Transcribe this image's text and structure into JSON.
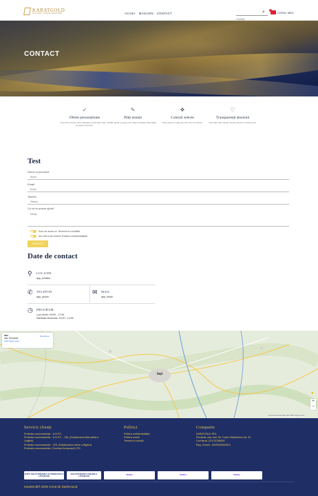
{
  "header": {
    "logo_text": "KARATGOLD",
    "logo_sub": "BIJUTERII ONLINE MAGAZINE",
    "nav": [
      "ACASA",
      "MAGAZIN",
      "CONTACT"
    ],
    "search_placeholder": "Cautare",
    "cart_label": "COSUL MEU",
    "cart_count": "0"
  },
  "hero": {
    "title": "CONTACT"
  },
  "features": [
    {
      "icon": "✓",
      "title": "Oferte personalizate",
      "desc": "Promotii si oferte unice adaptate preferintelor tale, cu beneficii exclusive."
    },
    {
      "icon": "✎",
      "title": "Plăți instant",
      "desc": "Plăți rapide si sigure prin toate metodele disponibile."
    },
    {
      "icon": "❖",
      "title": "Colecții selecte",
      "desc": "Piese alese cu grija din cele mai noi colectii."
    },
    {
      "icon": "♡",
      "title": "Transparență absolută",
      "desc": "Informatii clare despre fiecare produs si fiecare pret."
    }
  ],
  "form": {
    "title": "Test",
    "fields": [
      {
        "label": "Nume și prenume",
        "placeholder": "Nume"
      },
      {
        "label": "Email",
        "placeholder": "Email"
      },
      {
        "label": "Telefon",
        "placeholder": "Telefon"
      }
    ],
    "message_label": "Cu ce te putem ajuta?",
    "message_placeholder": "Mesaj",
    "toggle_terms": "Sunt de acord cu Termenii si conditiile",
    "toggle_privacy": "Am citit si am inteles Politica confidentialitatii",
    "submit": "TRIMITE"
  },
  "contact": {
    "title": "Date de contact",
    "location_label": "LOCAȚIE",
    "location_value": "app_location",
    "phone_label": "TELEFON",
    "phone_value": "app_phone",
    "mail_label": "MAIL",
    "mail_value": "app_email",
    "program_label": "PROGRAM",
    "program_line1": "Luni-Vineri: 09:00 - 17:00",
    "program_line2": "Sambata-Duminica: 10:00 - 14:00"
  },
  "map": {
    "box_title": "Iasi",
    "box_sub": "Iasi, Romania",
    "box_link": "View larger map",
    "directions": "Directions",
    "city": "Iași",
    "attribution": "Keyboard shortcuts  Map data ©2025 Google  Terms"
  },
  "footer": {
    "col1_title": "Servicii clienți",
    "col1_links": [
      "Protecția consumatorilor - A.N.P.C.",
      "Protecția consumatorilor - A.N.P.C. - SAL (Soluționarea Alternativă a Litigiilor)",
      "Protecția consumatorilor - SOL (Soluționarea online a litigiilor)",
      "Protecția consumatorilor | Comisia Europeană | RO"
    ],
    "col2_title": "Politici",
    "col2_links": [
      "Politica confidențialitate",
      "Politica cookie",
      "Termeni si condiții"
    ],
    "col3_title": "Companie",
    "col3_lines": [
      "KARATGOLD SRL",
      "Romania, Iasi, Iasi, Str. Tudor Vladimirescu Nr. 42",
      "Cod fiscal | CUI 51088541",
      "Reg. Comert. J2025000000001"
    ],
    "badges": [
      "ANPC SOLUTIONAREA ALTERNATIVA A LITIGIILOR",
      "SOLUȚIONAREA ONLINE A LITIGIILOR",
      "Mokka",
      "Mokka",
      "Mokka"
    ],
    "copyright": "KaratGold® 2025 Creat de DarkHound"
  }
}
